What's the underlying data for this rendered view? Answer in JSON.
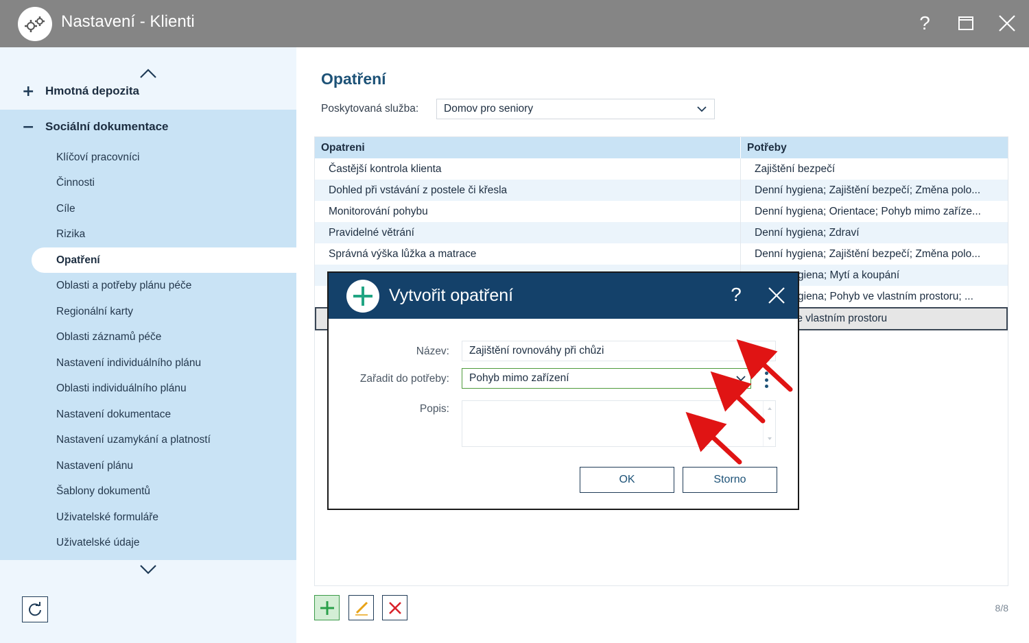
{
  "window": {
    "title": "Nastavení - Klienti",
    "help_label": "?"
  },
  "sidebar": {
    "groups": [
      {
        "sign": "+",
        "label": "Hmotná depozita"
      },
      {
        "sign": "−",
        "label": "Sociální dokumentace"
      }
    ],
    "items": [
      {
        "label": "Klíčoví pracovníci"
      },
      {
        "label": "Činnosti"
      },
      {
        "label": "Cíle"
      },
      {
        "label": "Rizika"
      },
      {
        "label": "Opatření"
      },
      {
        "label": "Oblasti a potřeby plánu péče"
      },
      {
        "label": "Regionální karty"
      },
      {
        "label": "Oblasti záznamů péče"
      },
      {
        "label": "Nastavení individuálního plánu"
      },
      {
        "label": "Oblasti individuálního plánu"
      },
      {
        "label": "Nastavení dokumentace"
      },
      {
        "label": "Nastavení uzamykání a platností"
      },
      {
        "label": "Nastavení plánu"
      },
      {
        "label": "Šablony dokumentů"
      },
      {
        "label": "Uživatelské formuláře"
      },
      {
        "label": "Uživatelské údaje"
      }
    ],
    "active_item": "Opatření"
  },
  "main": {
    "title": "Opatření",
    "service_label": "Poskytovaná služba:",
    "service_value": "Domov pro seniory",
    "columns": [
      "Opatreni",
      "Potřeby"
    ],
    "rows": [
      {
        "c1": "Častější kontrola klienta",
        "c2": "Zajištění bezpečí"
      },
      {
        "c1": "Dohled při vstávání z postele či křesla",
        "c2": "Denní hygiena; Zajištění bezpečí; Změna polo..."
      },
      {
        "c1": "Monitorování pohybu",
        "c2": "Denní hygiena; Orientace; Pohyb mimo zaříze..."
      },
      {
        "c1": "Pravidelné větrání",
        "c2": "Denní hygiena; Zdraví"
      },
      {
        "c1": "Správná výška lůžka a matrace",
        "c2": "Denní hygiena; Zajištění bezpečí; Změna polo..."
      },
      {
        "c1": "",
        "c2": "giena; Mytí a koupání"
      },
      {
        "c1": "",
        "c2": "giena; Pohyb ve vlastním prostoru; ..."
      },
      {
        "c1": "",
        "c2": "e vlastním prostoru"
      }
    ],
    "counter": "8/8"
  },
  "dialog": {
    "title": "Vytvořit opatření",
    "help_label": "?",
    "name_label": "Název:",
    "name_value": "Zajištění rovnováhy při chůzi",
    "category_label": "Zařadit do potřeby:",
    "category_value": "Pohyb mimo zařízení",
    "description_label": "Popis:",
    "description_value": "",
    "ok_label": "OK",
    "cancel_label": "Storno"
  },
  "colors": {
    "titlebar": "#858585",
    "sidebar_bg": "#eef6fd",
    "sidebar_list": "#c9e3f5",
    "dialog_header": "#14416a",
    "accent": "#1d5277",
    "add_green": "#2aa04a",
    "delete_red": "#d9222a",
    "annotation_arrow": "#e01414"
  }
}
